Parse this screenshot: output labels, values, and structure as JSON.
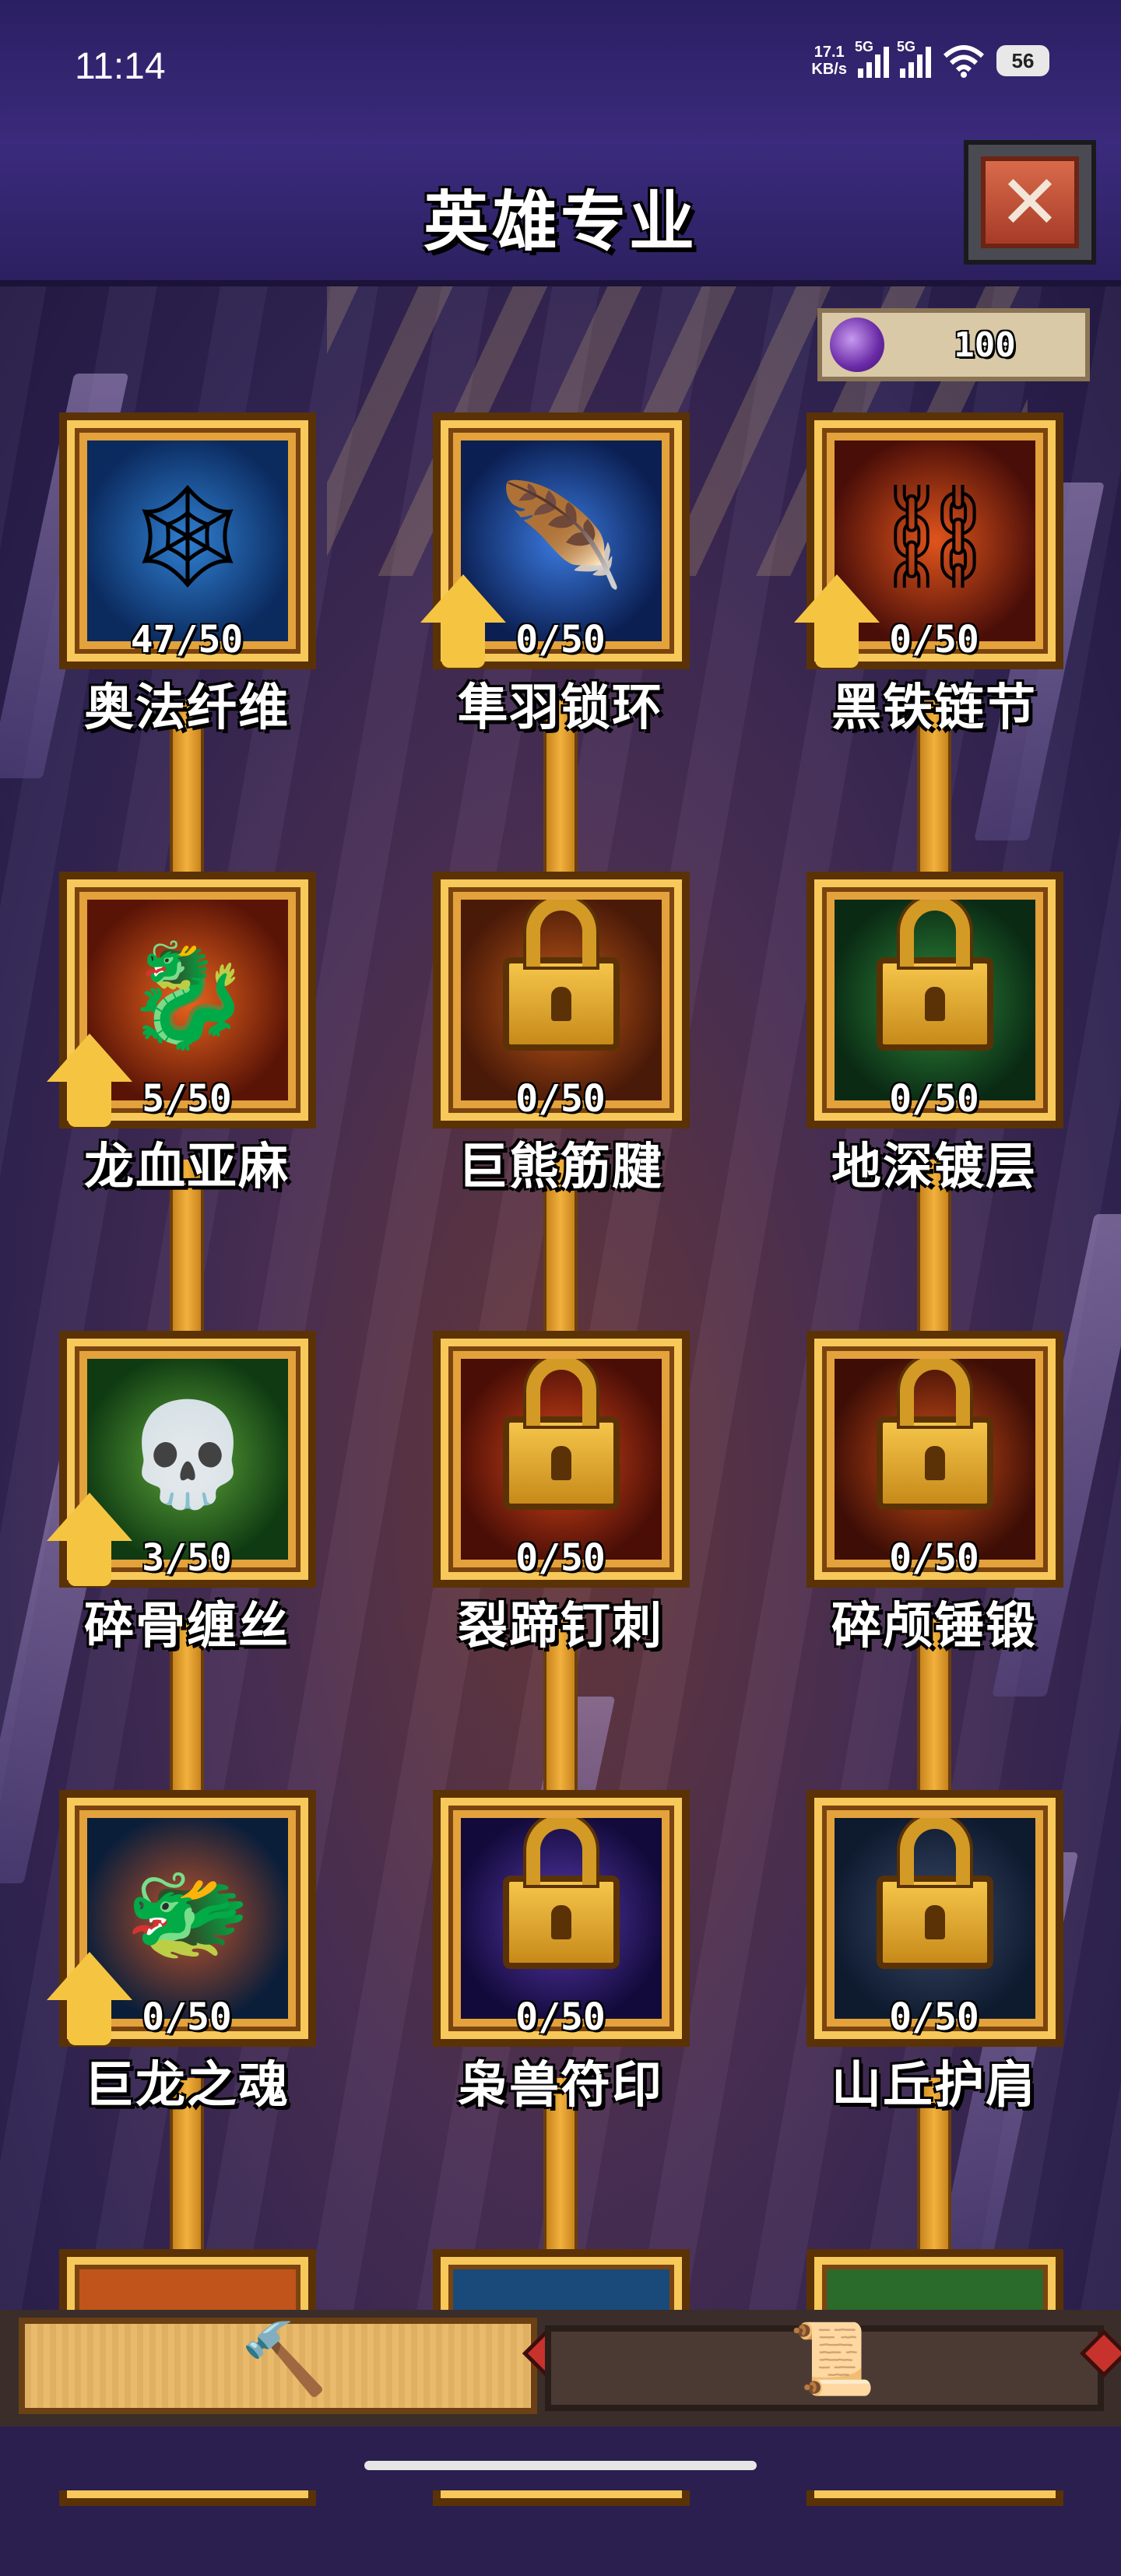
{
  "status_bar": {
    "time": "11:14",
    "net_speed_value": "17.1",
    "net_speed_unit": "KB/s",
    "sim1": "5G",
    "sim2": "5G",
    "battery": "56"
  },
  "header": {
    "title": "英雄专业",
    "close_symbol": "✕"
  },
  "currency": {
    "icon": "purple-essence-orb-icon",
    "value": "100"
  },
  "skills": [
    {
      "name": "奥法纤维",
      "level": "47/50",
      "locked": false,
      "upgradable": false,
      "glyph": "🕸",
      "colors": [
        "#0b2a5e",
        "#2f7fd1"
      ]
    },
    {
      "name": "隼羽锁环",
      "level": "0/50",
      "locked": false,
      "upgradable": true,
      "glyph": "🪶",
      "colors": [
        "#0b1f52",
        "#3a7ae0"
      ]
    },
    {
      "name": "黑铁链节",
      "level": "0/50",
      "locked": false,
      "upgradable": true,
      "glyph": "⛓",
      "colors": [
        "#4a0e08",
        "#e0541c"
      ]
    },
    {
      "name": "龙血亚麻",
      "level": "5/50",
      "locked": false,
      "upgradable": true,
      "glyph": "🐉",
      "colors": [
        "#5a1406",
        "#e8631e"
      ]
    },
    {
      "name": "巨熊筋腱",
      "level": "0/50",
      "locked": true,
      "upgradable": false,
      "glyph": "",
      "colors": [
        "#4a1a08",
        "#c25a18"
      ]
    },
    {
      "name": "地深镀层",
      "level": "0/50",
      "locked": true,
      "upgradable": false,
      "glyph": "",
      "colors": [
        "#0a2a14",
        "#2f8a3a"
      ]
    },
    {
      "name": "碎骨缠丝",
      "level": "3/50",
      "locked": false,
      "upgradable": true,
      "glyph": "💀",
      "colors": [
        "#0f3a12",
        "#5ea83a"
      ]
    },
    {
      "name": "裂蹄钉刺",
      "level": "0/50",
      "locked": true,
      "upgradable": false,
      "glyph": "",
      "colors": [
        "#4a0e06",
        "#d8461a"
      ]
    },
    {
      "name": "碎颅锤锻",
      "level": "0/50",
      "locked": true,
      "upgradable": false,
      "glyph": "",
      "colors": [
        "#3e0e06",
        "#d05018"
      ]
    },
    {
      "name": "巨龙之魂",
      "level": "0/50",
      "locked": false,
      "upgradable": true,
      "glyph": "🐲",
      "colors": [
        "#0a1e3a",
        "#c0542a"
      ]
    },
    {
      "name": "枭兽符印",
      "level": "0/50",
      "locked": true,
      "upgradable": false,
      "glyph": "",
      "colors": [
        "#120a3a",
        "#5a3ab0"
      ]
    },
    {
      "name": "山丘护肩",
      "level": "0/50",
      "locked": true,
      "upgradable": false,
      "glyph": "",
      "colors": [
        "#0e1a2e",
        "#3a4a6a"
      ]
    }
  ],
  "tabbar": {
    "tabs": [
      {
        "icon": "hammer-icon",
        "glyph": "🔨",
        "active": true
      },
      {
        "icon": "scroll-icon",
        "glyph": "📜",
        "active": false
      }
    ]
  }
}
